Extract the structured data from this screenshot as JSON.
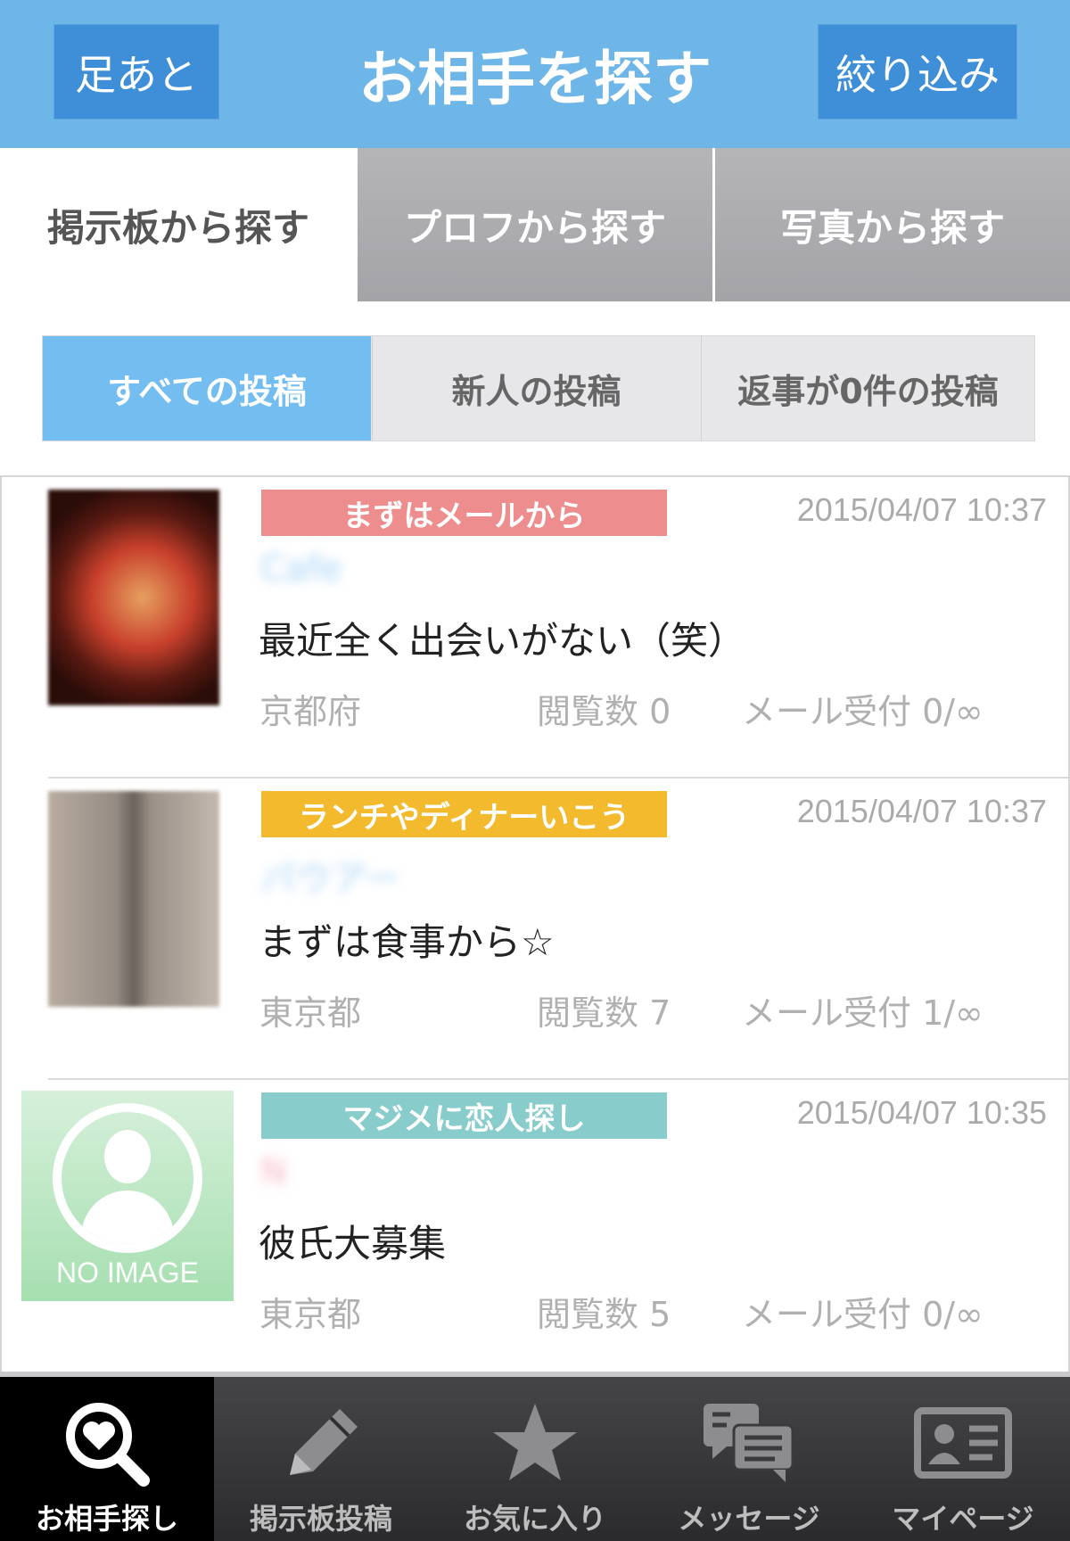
{
  "header": {
    "left_button": "足あと",
    "title": "お相手を探す",
    "right_button": "絞り込み"
  },
  "main_tabs": [
    {
      "label": "掲示板から探す",
      "active": true
    },
    {
      "label": "プロフから探す",
      "active": false
    },
    {
      "label": "写真から探す",
      "active": false
    }
  ],
  "sub_tabs": [
    {
      "label": "すべての投稿",
      "active": true
    },
    {
      "label": "新人の投稿",
      "active": false
    },
    {
      "label": "返事が0件の投稿",
      "active": false
    }
  ],
  "posts": [
    {
      "category": "まずはメールから",
      "category_color": "#ee8d8d",
      "datetime": "2015/04/07 10:37",
      "nickname": "Cafe",
      "nickname_color": "#a8d2f5",
      "message": "最近全く出会いがない（笑）",
      "prefecture": "京都府",
      "views": "閲覧数 0",
      "mail": "メール受付 0/∞"
    },
    {
      "category": "ランチやディナーいこう",
      "category_color": "#f2ba2c",
      "datetime": "2015/04/07 10:37",
      "nickname": "パウアー",
      "nickname_color": "#a8d2f5",
      "message": "まずは食事から☆",
      "prefecture": "東京都",
      "views": "閲覧数 7",
      "mail": "メール受付 1/∞"
    },
    {
      "category": "マジメに恋人探し",
      "category_color": "#88cccc",
      "datetime": "2015/04/07 10:35",
      "nickname": "N",
      "nickname_color": "#f5b8c4",
      "message": "彼氏大募集",
      "prefecture": "東京都",
      "views": "閲覧数 5",
      "mail": "メール受付 0/∞",
      "no_image_label": "NO IMAGE"
    }
  ],
  "bottom_nav": [
    {
      "label": "お相手探し",
      "icon": "search-heart-icon",
      "active": true
    },
    {
      "label": "掲示板投稿",
      "icon": "pencil-icon",
      "active": false
    },
    {
      "label": "お気に入り",
      "icon": "star-icon",
      "active": false
    },
    {
      "label": "メッセージ",
      "icon": "chat-bubbles-icon",
      "active": false
    },
    {
      "label": "マイページ",
      "icon": "id-card-icon",
      "active": false
    }
  ]
}
